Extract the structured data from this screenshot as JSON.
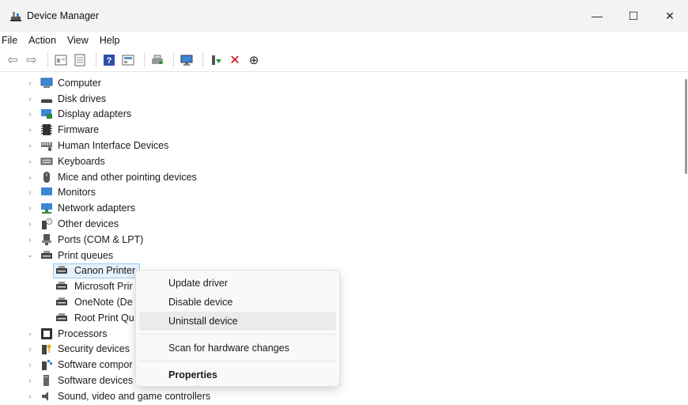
{
  "window": {
    "title": "Device Manager",
    "controls": {
      "minimize": "—",
      "maximize": "☐",
      "close": "✕"
    }
  },
  "menu": [
    "File",
    "Action",
    "View",
    "Help"
  ],
  "toolbar": {
    "buttons": [
      "back-icon",
      "forward-icon",
      "properties-icon",
      "view-icon",
      "help-icon",
      "view-hidden-icon",
      "scan-icon",
      "monitor-icon",
      "update-driver-icon",
      "uninstall-icon",
      "download-icon"
    ],
    "icon_glyphs": {
      "back": "⇦",
      "forward": "⇨",
      "help": "?",
      "uninstall": "✕",
      "download": "⊕"
    }
  },
  "tree": {
    "categories": [
      {
        "label": "Computer",
        "icon": "computer-icon",
        "expanded": false
      },
      {
        "label": "Disk drives",
        "icon": "disk-drive-icon",
        "expanded": false
      },
      {
        "label": "Display adapters",
        "icon": "display-adapter-icon",
        "expanded": false
      },
      {
        "label": "Firmware",
        "icon": "firmware-icon",
        "expanded": false
      },
      {
        "label": "Human Interface Devices",
        "icon": "hid-icon",
        "expanded": false
      },
      {
        "label": "Keyboards",
        "icon": "keyboard-icon",
        "expanded": false
      },
      {
        "label": "Mice and other pointing devices",
        "icon": "mouse-icon",
        "expanded": false
      },
      {
        "label": "Monitors",
        "icon": "monitor-icon",
        "expanded": false
      },
      {
        "label": "Network adapters",
        "icon": "network-adapter-icon",
        "expanded": false
      },
      {
        "label": "Other devices",
        "icon": "other-devices-icon",
        "expanded": false
      },
      {
        "label": "Ports (COM & LPT)",
        "icon": "port-icon",
        "expanded": false
      },
      {
        "label": "Print queues",
        "icon": "printer-icon",
        "expanded": true
      },
      {
        "label": "Processors",
        "icon": "processor-icon",
        "expanded": false
      },
      {
        "label": "Security devices",
        "icon": "security-device-icon",
        "expanded": false
      },
      {
        "label": "Software compor",
        "icon": "software-component-icon",
        "expanded": false
      },
      {
        "label": "Software devices",
        "icon": "software-device-icon",
        "expanded": false
      },
      {
        "label": "Sound, video and game controllers",
        "icon": "sound-icon",
        "expanded": false
      }
    ],
    "print_queue_children": [
      {
        "label": "Canon Printer",
        "selected": true
      },
      {
        "label": "Microsoft Prir",
        "selected": false
      },
      {
        "label": "OneNote (De",
        "selected": false
      },
      {
        "label": "Root Print Qu",
        "selected": false
      }
    ],
    "chevron_collapsed": "›",
    "chevron_expanded": "⌄"
  },
  "context_menu": {
    "items": [
      "Update driver",
      "Disable device",
      "Uninstall device",
      "Scan for hardware changes",
      "Properties"
    ],
    "hovered": "Uninstall device",
    "bold": "Properties"
  },
  "colors": {
    "titlebar_bg": "#f3f3f3",
    "selection_bg": "#e5f1fb",
    "selection_border": "#99c9ef",
    "uninstall_red": "#d40000",
    "update_green": "#1c9a2f",
    "accent_blue": "#2f7fd8"
  }
}
